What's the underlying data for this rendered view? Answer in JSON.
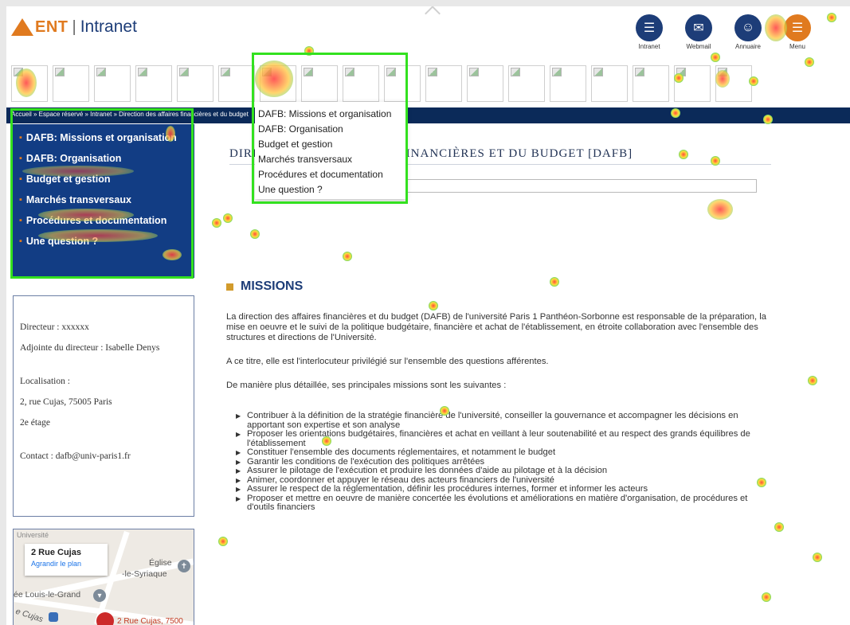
{
  "header": {
    "logo_ent": "ENT",
    "logo_sep": "|",
    "logo_title": "Intranet",
    "icons": [
      {
        "label": "Intranet",
        "icon": "intranet-icon",
        "color": "#1d3d78"
      },
      {
        "label": "Webmail",
        "icon": "mail-icon",
        "color": "#1d3d78"
      },
      {
        "label": "Annuaire",
        "icon": "directory-icon",
        "color": "#1d3d78"
      },
      {
        "label": "Menu",
        "icon": "menu-icon",
        "color": "#e07a1f"
      }
    ]
  },
  "breadcrumb": "Accueil » Espace réservé » Intranet » Direction des affaires financières et du budget",
  "side_menu": {
    "items": [
      "DAFB: Missions et organisation",
      "DAFB: Organisation",
      "Budget et gestion",
      "Marchés transversaux",
      "Procédures et documentation",
      "Une question ?"
    ]
  },
  "dropdown": {
    "items": [
      "DAFB: Missions et organisation",
      "DAFB: Organisation",
      "Budget et gestion",
      "Marchés transversaux",
      "Procédures et documentation",
      "Une question ?"
    ]
  },
  "page_title": "DIRECTION DES AFFAIRES FINANCIÈRES ET DU BUDGET [DAFB]",
  "info": {
    "director": "Directeur : xxxxxx",
    "deputy": "Adjointe du directeur : Isabelle Denys",
    "location_label": "Localisation :",
    "address": "2, rue Cujas, 75005 Paris",
    "floor": "2e étage",
    "contact": "Contact : dafb@univ-paris1.fr"
  },
  "map": {
    "card_title": "2 Rue Cujas",
    "card_link": "Agrandir le plan",
    "label_univ": "Université",
    "label_church": "Église",
    "label_church2": "-le-Syriaque",
    "label_lycee": "ée Louis-le-Grand",
    "label_street": "e Cujas",
    "label_pin": "2 Rue Cujas, 7500"
  },
  "missions": {
    "heading": "MISSIONS",
    "p1": "La direction des affaires financières et du budget (DAFB) de l'université Paris 1 Panthéon-Sorbonne est responsable de la préparation, la mise en oeuvre et le suivi de la politique budgétaire, financière et achat de l'établissement, en étroite collaboration avec l'ensemble des structures et directions de l'Université.",
    "p2": "A ce titre, elle est l'interlocuteur privilégié sur l'ensemble des questions afférentes.",
    "p3": "De manière plus détaillée, ses principales missions sont les suivantes :",
    "list": [
      "Contribuer à la définition de la stratégie financière de l'université, conseiller la gouvernance et accompagner les décisions en apportant son expertise et son analyse",
      "Proposer les orientations budgétaires, financières et achat en veillant à leur soutenabilité et au respect des grands équilibres de l'établissement",
      "Constituer l'ensemble des documents réglementaires, et notamment le budget",
      "Garantir les conditions de l'exécution des politiques arrêtées",
      "Assurer le pilotage de l'exécution et produire les données d'aide au pilotage et à la décision",
      "Animer, coordonner et appuyer le réseau des acteurs financiers de l'université",
      "Assurer le respect de la réglementation, définir les procédures internes, former et informer les acteurs",
      "Proposer et mettre en oeuvre de manière concertée les évolutions et améliorations en matière d'organisation, de procédures et d'outils financiers"
    ]
  },
  "colors": {
    "navy": "#0b2a59",
    "menu_blue": "#123d84",
    "accent_orange": "#e07a1f",
    "highlight_green": "#33e11f"
  }
}
